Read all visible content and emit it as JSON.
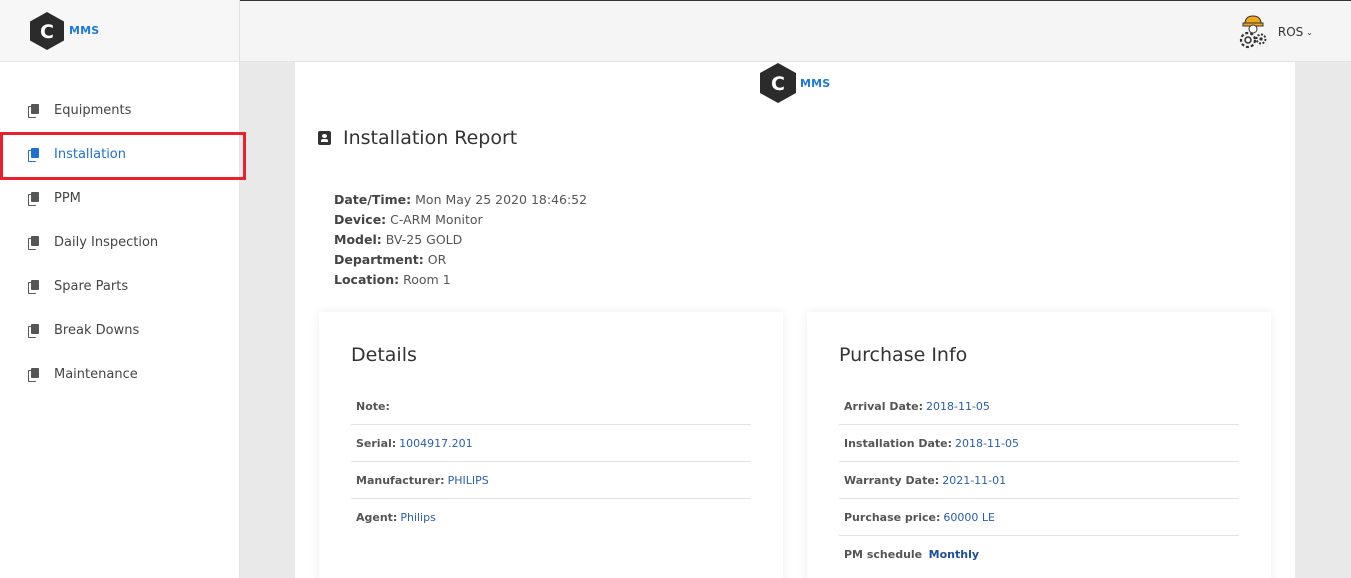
{
  "brand": {
    "logo_letter": "C",
    "logo_text": "MMS",
    "accent": "#1e7ad9",
    "logo_color": "#2b2b2b"
  },
  "sidebar": {
    "items": [
      {
        "label": "Equipments",
        "icon": "copy-icon",
        "active": false
      },
      {
        "label": "Installation",
        "icon": "copy-icon",
        "active": true
      },
      {
        "label": "PPM",
        "icon": "copy-icon",
        "active": false
      },
      {
        "label": "Daily Inspection",
        "icon": "copy-icon",
        "active": false
      },
      {
        "label": "Spare Parts",
        "icon": "copy-icon",
        "active": false
      },
      {
        "label": "Break Downs",
        "icon": "copy-icon",
        "active": false
      },
      {
        "label": "Maintenance",
        "icon": "copy-icon",
        "active": false
      }
    ],
    "highlight_color": "#e8212c",
    "active_color": "#1e6fcf"
  },
  "topbar": {
    "user_name": "ROS",
    "user_icon": "engineer-gear-icon",
    "chevron": "chevron-down-icon"
  },
  "report": {
    "title": "Installation Report",
    "title_icon": "id-card-icon",
    "meta": [
      {
        "key": "Date/Time:",
        "value": "Mon May 25 2020 18:46:52"
      },
      {
        "key": "Device:",
        "value": "C-ARM Monitor"
      },
      {
        "key": "Model:",
        "value": "BV-25 GOLD"
      },
      {
        "key": "Department:",
        "value": "OR"
      },
      {
        "key": "Location:",
        "value": "Room 1"
      }
    ],
    "details": {
      "title": "Details",
      "rows": [
        {
          "key": "Note:",
          "value": ""
        },
        {
          "key": "Serial:",
          "value": "1004917.201"
        },
        {
          "key": "Manufacturer:",
          "value": "PHILIPS"
        },
        {
          "key": "Agent:",
          "value": "Philips"
        }
      ]
    },
    "purchase": {
      "title": "Purchase Info",
      "rows": [
        {
          "key": "Arrival Date:",
          "value": "2018-11-05"
        },
        {
          "key": "Installation Date:",
          "value": "2018-11-05"
        },
        {
          "key": "Warranty Date:",
          "value": "2021-11-01"
        },
        {
          "key": "Purchase price:",
          "value": "60000 LE"
        },
        {
          "key": "PM schedule",
          "value": "Monthly"
        }
      ]
    }
  }
}
